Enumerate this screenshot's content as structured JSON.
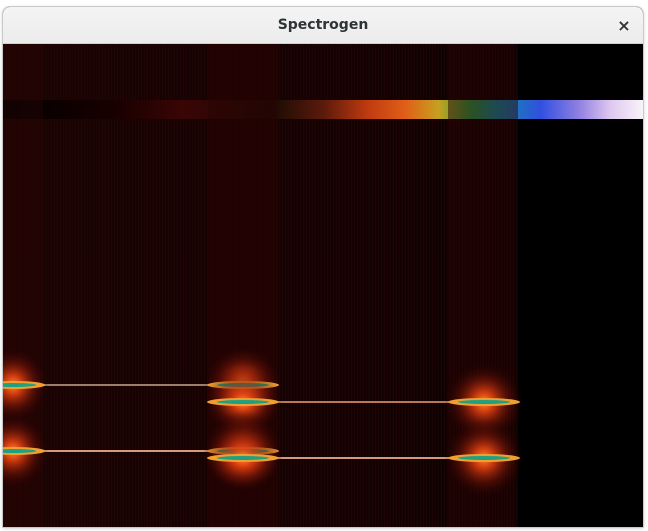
{
  "window": {
    "title": "Spectrogen"
  },
  "titlebar": {
    "close_icon": "close-icon",
    "close_glyph": "×"
  },
  "colormap": {
    "stops": [
      "#000000",
      "#1a0000",
      "#3a0505",
      "#1a0b05",
      "#5a1a0a",
      "#c03a10",
      "#e06018",
      "#c8a020",
      "#30a040",
      "#1090a0",
      "#3050e0",
      "#9080e0",
      "#e0c8f0",
      "#f8f4f8"
    ]
  },
  "spectrogram": {
    "background": "#000000",
    "tone_colors": {
      "core": "#ffffff",
      "line": "#f0b090",
      "glow": "#e04010",
      "halo": "#300000"
    }
  }
}
